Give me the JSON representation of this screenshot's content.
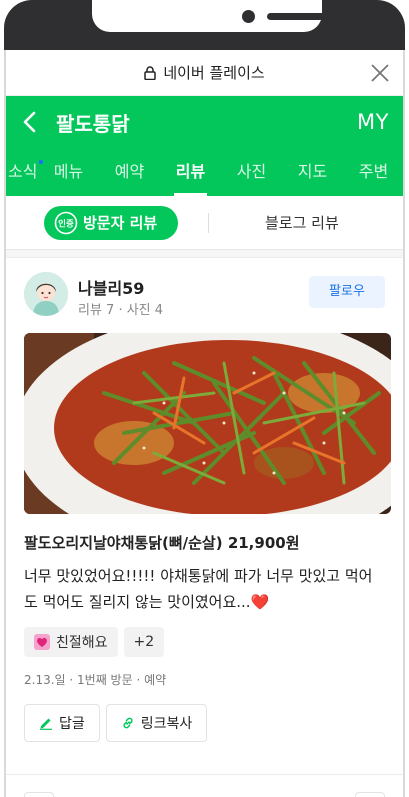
{
  "browser": {
    "url_title": "네이버 플레이스",
    "lock_icon": "lock-icon",
    "close_icon": "close-icon"
  },
  "header": {
    "back_icon": "chevron-left-icon",
    "title": "팔도통닭",
    "my_label": "MY",
    "color": "#03c75a"
  },
  "tabs": [
    {
      "label": "소식",
      "new_dot": true
    },
    {
      "label": "메뉴"
    },
    {
      "label": "예약"
    },
    {
      "label": "리뷰",
      "active": true
    },
    {
      "label": "사진"
    },
    {
      "label": "지도"
    },
    {
      "label": "주변"
    }
  ],
  "review_type": {
    "cert_badge": "인증",
    "visitor_label": "방문자 리뷰",
    "blog_label": "블로그 리뷰"
  },
  "review": {
    "author": "나블리59",
    "meta": "리뷰 7 · 사진 4",
    "follow_label": "팔로우",
    "menu": "팔도오리지날야채통닭(뼈/순살) 21,900원",
    "text": "너무 맛있었어요!!!!! 야채통닭에 파가 너무 맛있고 먹어도 먹어도 질리지 않는 맛이였어요...",
    "emoji": "❤️",
    "keywords": [
      {
        "label": "친절해요",
        "icon": "heart-icon"
      },
      {
        "label": "+2"
      }
    ],
    "visit_info": "2.13.일 · 1번째 방문 · 예약",
    "actions": {
      "reply_label": "답글",
      "copy_link_label": "링크복사"
    }
  }
}
